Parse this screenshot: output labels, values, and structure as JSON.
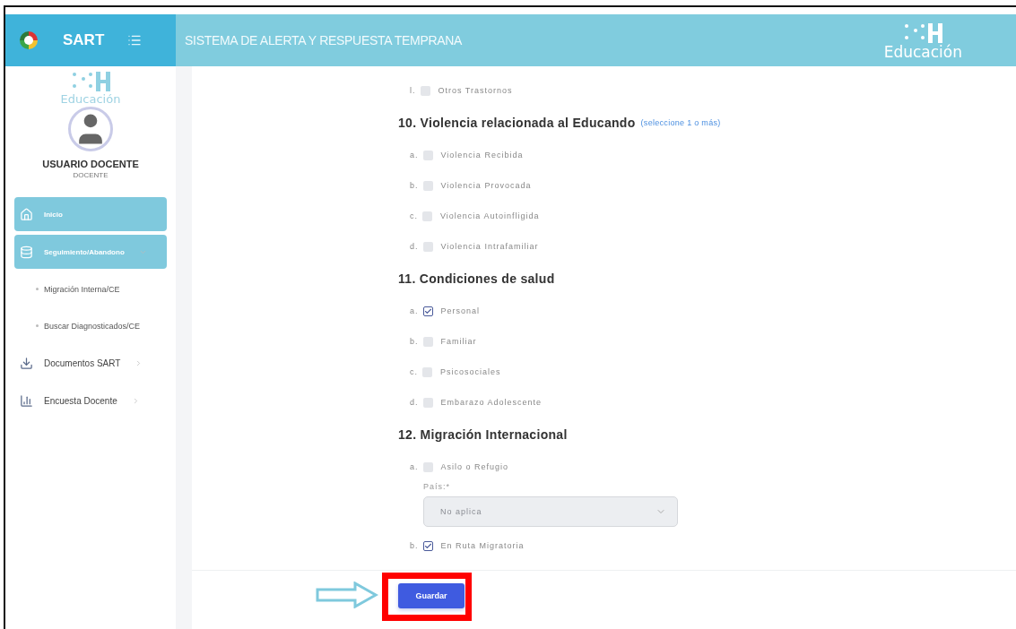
{
  "header": {
    "app_name": "SART",
    "title": "SISTEMA DE ALERTA Y RESPUESTA TEMPRANA",
    "logo_text": "Educación"
  },
  "sidebar": {
    "logo_text": "Educación",
    "user_name": "USUARIO DOCENTE",
    "user_role": "DOCENTE",
    "items": [
      {
        "label": "Inicio",
        "selected": true
      },
      {
        "label": "Seguimiento/Abandono",
        "selected": true,
        "expanded": true,
        "children": [
          {
            "label": "Migración Interna/CE"
          },
          {
            "label": "Buscar Diagnosticados/CE"
          }
        ]
      },
      {
        "label": "Documentos SART",
        "selected": false,
        "expanded": false
      },
      {
        "label": "Encuesta Docente",
        "selected": false,
        "expanded": false
      }
    ]
  },
  "form": {
    "previous_options": [
      {
        "letter": "l.",
        "label": "Otros Trastornos",
        "checked": false
      }
    ],
    "sections": [
      {
        "number": "10.",
        "title": "Violencia relacionada al Educando",
        "hint": "(seleccione 1 o más)",
        "options": [
          {
            "letter": "a.",
            "label": "Violencia Recibida",
            "checked": false
          },
          {
            "letter": "b.",
            "label": "Violencia Provocada",
            "checked": false
          },
          {
            "letter": "c.",
            "label": "Violencia Autoinfligida",
            "checked": false
          },
          {
            "letter": "d.",
            "label": "Violencia Intrafamiliar",
            "checked": false
          }
        ]
      },
      {
        "number": "11.",
        "title": "Condiciones de salud",
        "options": [
          {
            "letter": "a.",
            "label": "Personal",
            "checked": true
          },
          {
            "letter": "b.",
            "label": "Familiar",
            "checked": false
          },
          {
            "letter": "c.",
            "label": "Psicosociales",
            "checked": false
          },
          {
            "letter": "d.",
            "label": "Embarazo Adolescente",
            "checked": false
          }
        ]
      },
      {
        "number": "12.",
        "title": "Migración Internacional",
        "options": [
          {
            "letter": "a.",
            "label": "Asilo o Refugio",
            "checked": false,
            "field": {
              "label": "País:*",
              "value": "No aplica",
              "disabled": true
            }
          },
          {
            "letter": "b.",
            "label": "En Ruta Migratoria",
            "checked": true
          }
        ]
      }
    ],
    "save_button": {
      "label": "Guardar",
      "highlighted": true
    }
  }
}
